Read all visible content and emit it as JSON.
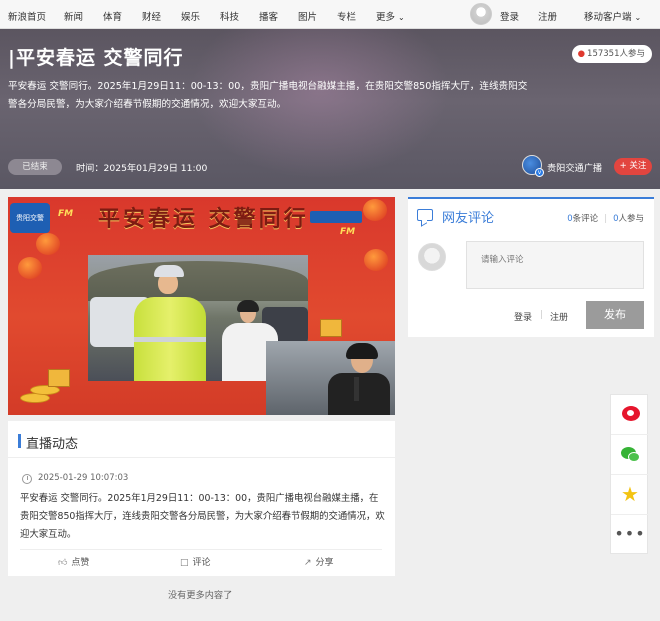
{
  "nav": {
    "items": [
      "新浪首页",
      "新闻",
      "体育",
      "财经",
      "娱乐",
      "科技",
      "播客",
      "图片",
      "专栏",
      "更多"
    ],
    "login": "登录",
    "register": "注册",
    "mobile": "移动客户端"
  },
  "hero": {
    "title": "|平安春运 交警同行",
    "description": "平安春运 交警同行。2025年1月29日11：00-13：00，贵阳广播电视台融媒主播，在贵阳交警850指挥大厅，连线贵阳交警各分局民警，为大家介绍春节假期的交通情况，欢迎大家互动。",
    "participants": "157351人参与",
    "status": "已结束",
    "time": "时间：2025年01月29日 11:00",
    "channel": "贵阳交通广播",
    "follow": "+ 关注"
  },
  "poster": {
    "banner": "平安春运 交警同行",
    "fm": "FM",
    "logo": "贵阳交警"
  },
  "feed": {
    "title": "直播动态",
    "timestamp": "2025-01-29 10:07:03",
    "body": "平安春运 交警同行。2025年1月29日11：00-13：00，贵阳广播电视台融媒主播，在贵阳交警850指挥大厅，连线贵阳交警各分局民警，为大家介绍春节假期的交通情况，欢迎大家互动。",
    "like": "点赞",
    "comment": "评论",
    "share": "分享",
    "no_more": "没有更多内容了"
  },
  "comments": {
    "title": "网友评论",
    "comment_count": "0",
    "comment_label": "条评论",
    "participant_count": "0",
    "participant_label": "人参与",
    "placeholder": "请输入评论",
    "login": "登录",
    "register": "注册",
    "publish": "发布"
  },
  "icons": {
    "weibo": "weibo-icon",
    "wechat": "wechat-icon",
    "favorite": "star-icon",
    "more": "more-icon"
  },
  "colors": {
    "accent": "#3b7dd8",
    "follow": "#e2453f",
    "hero_bg": "#5f5a66"
  }
}
